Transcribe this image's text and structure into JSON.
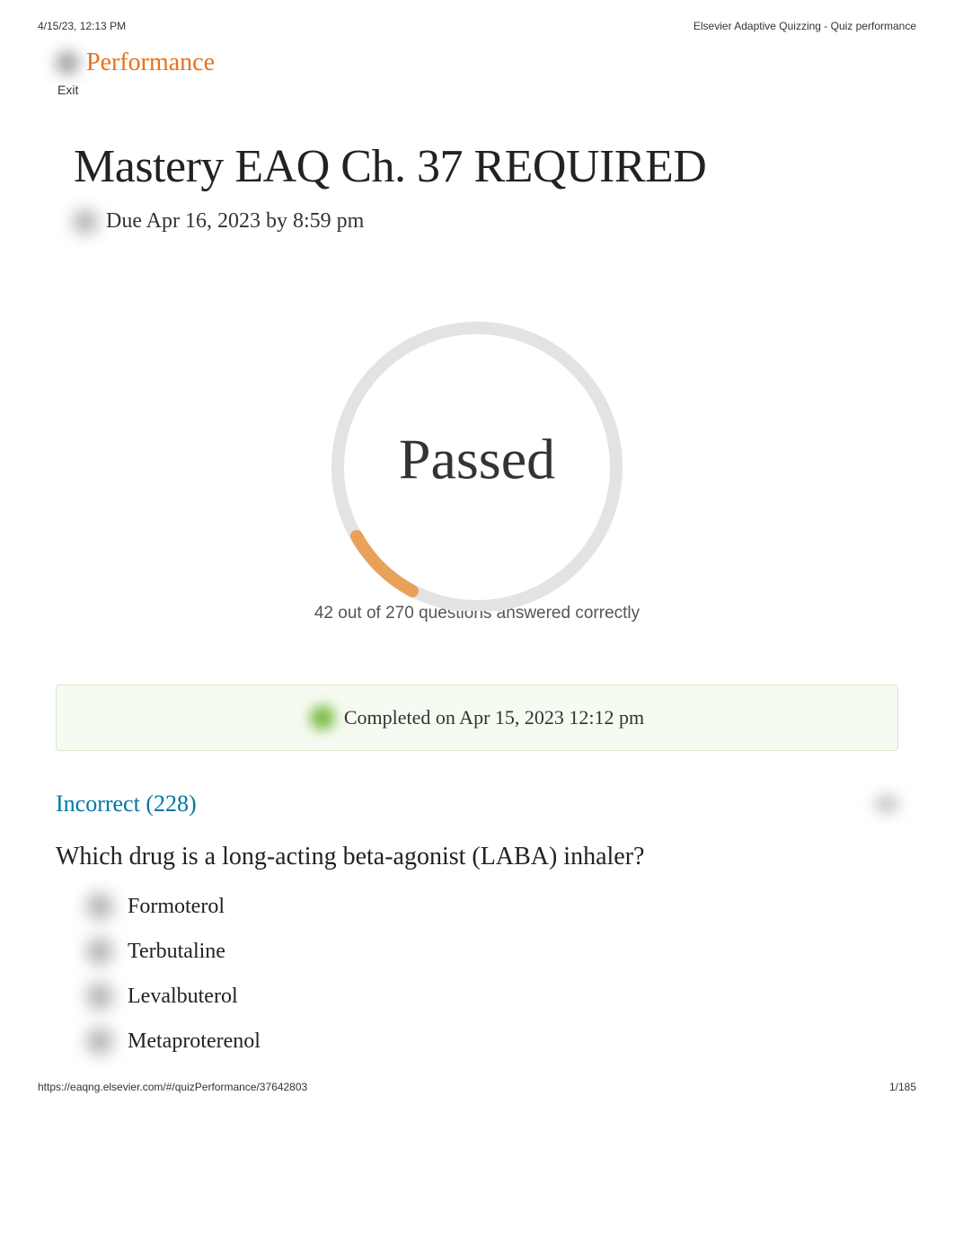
{
  "print_header": {
    "timestamp": "4/15/23, 12:13 PM",
    "page_title": "Elsevier Adaptive Quizzing - Quiz performance"
  },
  "nav": {
    "performance_label": "Performance",
    "exit_label": "Exit"
  },
  "quiz": {
    "title": "Mastery EAQ Ch. 37 REQUIRED",
    "due_text": "Due Apr 16, 2023 by 8:59 pm"
  },
  "result": {
    "status": "Passed",
    "score_text": "42 out of 270 questions answered correctly",
    "completed_text": "Completed on Apr 15, 2023 12:12 pm"
  },
  "section": {
    "incorrect_heading": "Incorrect (228)"
  },
  "question": {
    "text": "Which drug is a long-acting beta-agonist (LABA) inhaler?",
    "options": [
      "Formoterol",
      "Terbutaline",
      "Levalbuterol",
      "Metaproterenol"
    ]
  },
  "print_footer": {
    "url": "https://eaqng.elsevier.com/#/quizPerformance/37642803",
    "page_num": "1/185"
  }
}
